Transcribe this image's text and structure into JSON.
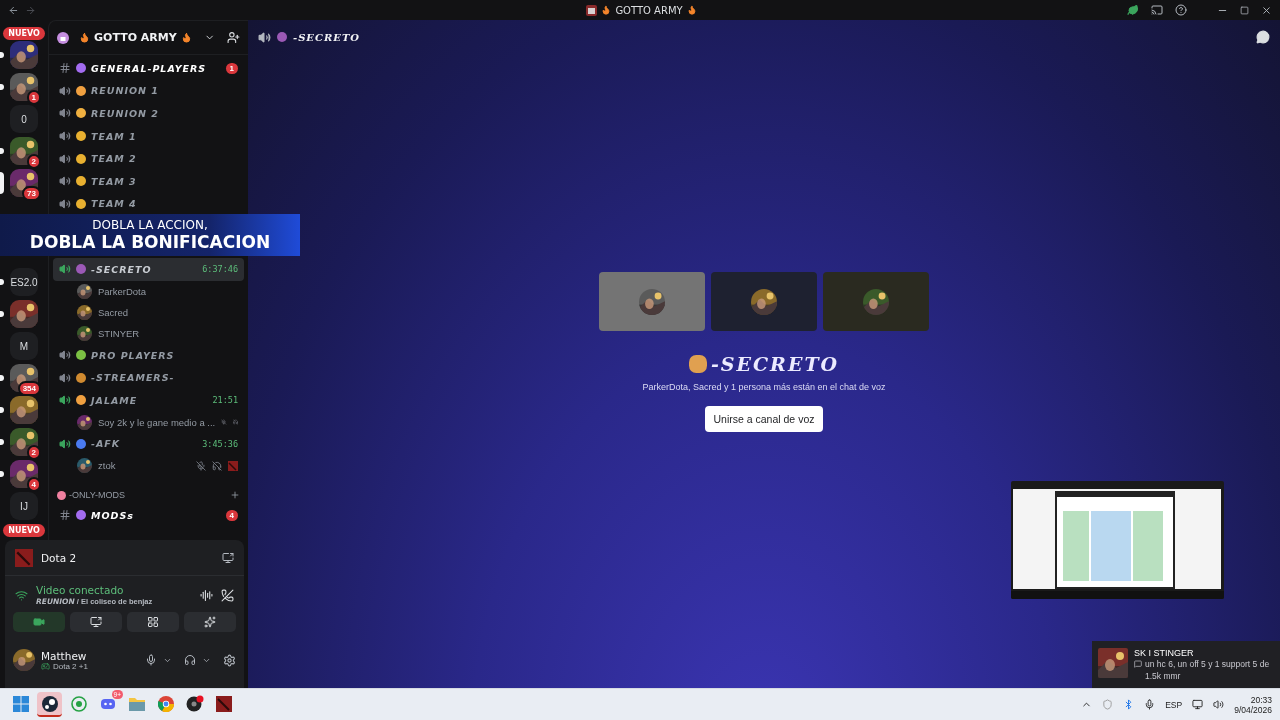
{
  "title_bar": {
    "title": "GOTTO ARMY"
  },
  "banner": {
    "line1": "DOBLA LA ACCION,",
    "line2": "DOBLA LA BONIFICACION"
  },
  "server_rail": {
    "items": [
      {
        "kind": "new",
        "label": "NUEVO"
      },
      {
        "kind": "picture",
        "unread": true,
        "selected": false
      },
      {
        "kind": "picture",
        "unread": true,
        "selected": false,
        "badge": "1"
      },
      {
        "kind": "letters",
        "label": "0",
        "unread": false,
        "selected": false
      },
      {
        "kind": "picture",
        "unread": true,
        "selected": false,
        "badge": "2"
      },
      {
        "kind": "picture",
        "unread": false,
        "selected": true,
        "badge": "73"
      },
      {
        "kind": "letters",
        "label": "ES2.0",
        "unread": true,
        "selected": false
      },
      {
        "kind": "picture",
        "unread": true,
        "selected": false
      },
      {
        "kind": "letters",
        "label": "M",
        "unread": false,
        "selected": false
      },
      {
        "kind": "picture",
        "unread": true,
        "selected": false,
        "badge": "354"
      },
      {
        "kind": "picture",
        "unread": true,
        "selected": false
      },
      {
        "kind": "picture",
        "unread": true,
        "selected": false,
        "badge": "2"
      },
      {
        "kind": "picture",
        "unread": true,
        "selected": false,
        "badge": "4"
      },
      {
        "kind": "letters",
        "label": "IJ",
        "unread": false,
        "selected": false
      },
      {
        "kind": "new",
        "label": "NUEVO"
      }
    ]
  },
  "sidebar": {
    "server": "GOTTO ARMY",
    "sections": [
      {
        "channels": [
          {
            "kind": "text",
            "name": "GENERAL-PLAYERS",
            "unread": true,
            "selected": false,
            "badge": "1"
          },
          {
            "kind": "voice",
            "name": "REUNION 1",
            "unread": false,
            "selected": false,
            "connected": false
          },
          {
            "kind": "voice",
            "name": "REUNION 2",
            "unread": false,
            "selected": false,
            "connected": false
          },
          {
            "kind": "voice",
            "name": "TEAM 1",
            "unread": false,
            "selected": false,
            "connected": false
          },
          {
            "kind": "voice",
            "name": "TEAM 2",
            "unread": false,
            "selected": false,
            "connected": false
          },
          {
            "kind": "voice",
            "name": "TEAM 3",
            "unread": false,
            "selected": false,
            "connected": false
          },
          {
            "kind": "voice",
            "name": "TEAM 4",
            "unread": false,
            "selected": false,
            "connected": false
          },
          {
            "kind": "voice",
            "name": "-SECRETO",
            "unread": false,
            "selected": true,
            "connected": true,
            "time": "6:37:46",
            "users": [
              {
                "name": "ParkerDota",
                "muted": false,
                "deafened": false,
                "playing": false
              },
              {
                "name": "Sacred",
                "muted": false,
                "deafened": false,
                "playing": false
              },
              {
                "name": "STINYER",
                "muted": false,
                "deafened": false,
                "playing": false
              }
            ]
          },
          {
            "kind": "voice",
            "name": "PRO PLAYERS",
            "unread": false,
            "selected": false,
            "connected": false
          },
          {
            "kind": "voice",
            "name": "-STREAMERS-",
            "unread": false,
            "selected": false,
            "connected": false
          },
          {
            "kind": "voice",
            "name": "JALAME",
            "unread": false,
            "selected": false,
            "connected": true,
            "time": "21:51",
            "users": [
              {
                "name": "Soy 2k y le gane medio a ...",
                "muted": true,
                "deafened": true,
                "playing": false
              }
            ]
          },
          {
            "kind": "voice",
            "name": "-AFK",
            "unread": false,
            "selected": false,
            "connected": true,
            "time": "3:45:36",
            "users": [
              {
                "name": "ztok",
                "muted": true,
                "deafened": true,
                "playing": true
              }
            ]
          }
        ]
      },
      {
        "category": "-ONLY-MODS",
        "channels": [
          {
            "kind": "text",
            "name": "MODSs",
            "unread": true,
            "selected": false,
            "badge": "4"
          }
        ]
      }
    ]
  },
  "panel": {
    "activity": "Dota 2",
    "voice_status": "Video conectado",
    "voice_channel": "REUNION",
    "voice_server": "/ El coliseo de benjaz",
    "controls": [
      {
        "kind": "camera",
        "selected": true
      },
      {
        "kind": "screen",
        "selected": false
      },
      {
        "kind": "activities",
        "selected": false
      },
      {
        "kind": "soundboard",
        "selected": false
      }
    ],
    "user": {
      "name": "Matthew",
      "status": "Dota 2 +1"
    }
  },
  "main": {
    "channel": "-SECRETO",
    "title": "-SECRETO",
    "subtitle": "ParkerDota, Sacred y 1 persona más están en el chat de voz",
    "join_button": "Unirse a canal de voz",
    "tiles": [
      {
        "kind": "picture"
      },
      {
        "kind": "picture"
      },
      {
        "kind": "picture"
      }
    ]
  },
  "toast": {
    "sender": "SK I STINGER",
    "message": "un hc 6, un off 5 y 1 support 5 de 1.5k mmr"
  },
  "taskbar": {
    "apps": [
      {
        "kind": "windows",
        "selected": false
      },
      {
        "kind": "steam",
        "selected": true
      },
      {
        "kind": "whatsapp",
        "selected": false
      },
      {
        "kind": "discord",
        "selected": false,
        "badge": "9+"
      },
      {
        "kind": "folder",
        "selected": false
      },
      {
        "kind": "chrome",
        "selected": false
      },
      {
        "kind": "recorder",
        "selected": false
      },
      {
        "kind": "dota",
        "selected": false
      }
    ],
    "language": "ESP",
    "time": "20:33",
    "date": "9/04/2026"
  }
}
